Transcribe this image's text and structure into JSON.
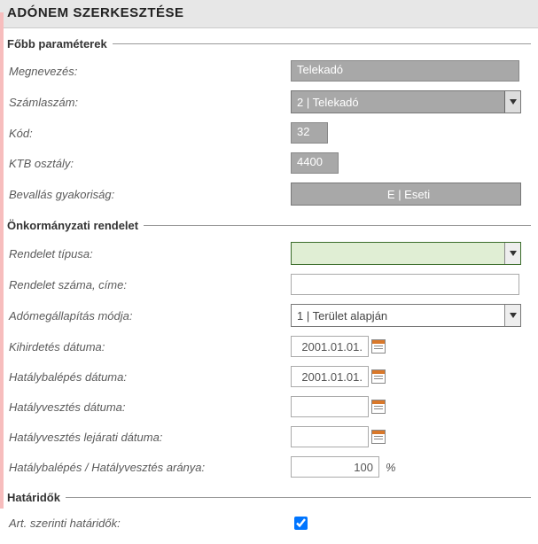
{
  "page_title": "ADÓNEM SZERKESZTÉSE",
  "sections": {
    "params": {
      "legend": "Főbb paraméterek",
      "name_label": "Megnevezés:",
      "name_value": "Telekadó",
      "account_label": "Számlaszám:",
      "account_value": "2 | Telekadó",
      "code_label": "Kód:",
      "code_value": "32",
      "ktb_label": "KTB osztály:",
      "ktb_value": "4400",
      "freq_label": "Bevallás gyakoriság:",
      "freq_value": "E | Eseti"
    },
    "decree": {
      "legend": "Önkormányzati rendelet",
      "type_label": "Rendelet típusa:",
      "type_value": "",
      "num_label": "Rendelet száma, címe:",
      "num_value": "",
      "method_label": "Adómegállapítás módja:",
      "method_value": "1 | Terület alapján",
      "pub_label": "Kihirdetés dátuma:",
      "pub_value": "2001.01.01.",
      "eff_label": "Hatálybalépés dátuma:",
      "eff_value": "2001.01.01.",
      "exp_label": "Hatályvesztés dátuma:",
      "exp_value": "",
      "expdue_label": "Hatályvesztés lejárati dátuma:",
      "expdue_value": "",
      "ratio_label": "Hatálybalépés / Hatályvesztés aránya:",
      "ratio_value": "100",
      "ratio_suffix": "%"
    },
    "deadlines": {
      "legend": "Határidők",
      "art_label": "Art. szerinti határidők:",
      "art_checked": true
    }
  }
}
